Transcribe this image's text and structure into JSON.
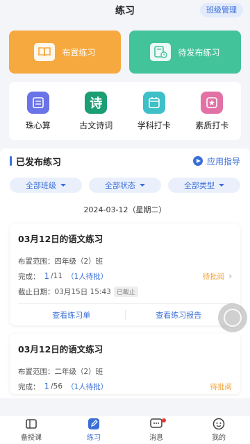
{
  "header": {
    "title": "练习",
    "class_manage": "班级管理"
  },
  "big_actions": [
    {
      "label": "布置练习",
      "icon": "book-icon"
    },
    {
      "label": "待发布练习",
      "icon": "clock-document-icon"
    }
  ],
  "shortcuts": [
    {
      "label": "珠心算",
      "icon": "abacus-icon",
      "color": "#6b73e8"
    },
    {
      "label": "古文诗词",
      "icon": "poem-icon",
      "color": "#1c9e74",
      "glyph": "诗"
    },
    {
      "label": "学科打卡",
      "icon": "calendar-icon",
      "color": "#3fc0c8"
    },
    {
      "label": "素质打卡",
      "icon": "star-badge-icon",
      "color": "#e272a6"
    }
  ],
  "published": {
    "title": "已发布练习",
    "guide_label": "应用指导",
    "filters": [
      "全部班级",
      "全部状态",
      "全部类型"
    ],
    "date": "2024-03-12（星期二）",
    "cards": [
      {
        "title": "03月12日的语文练习",
        "scope_label": "布置范围：",
        "scope_value": "四年级（2）班",
        "done_label": "完成：",
        "done_count": "1",
        "total": "/11",
        "pending": "（1人待批）",
        "status": "待批阅",
        "deadline_label": "截止日期：",
        "deadline_value": "03月15日 15:43",
        "deadline_badge": "已截止",
        "action_left": "查看练习单",
        "action_right": "查看练习报告"
      },
      {
        "title": "03月12日的语文练习",
        "scope_label": "布置范围：",
        "scope_value": "二年级（2）班",
        "done_label": "完成：",
        "done_count": "1",
        "total": "/56",
        "pending": "（1人待批）",
        "status": "待批阅"
      }
    ]
  },
  "tabbar": [
    {
      "label": "备授课",
      "icon": "book-open-icon",
      "active": false
    },
    {
      "label": "练习",
      "icon": "pencil-icon",
      "active": true
    },
    {
      "label": "消息",
      "icon": "message-icon",
      "active": false,
      "has_dot": true
    },
    {
      "label": "我的",
      "icon": "user-icon",
      "active": false
    }
  ],
  "colors": {
    "accent": "#3a6fd8",
    "orange": "#f6a93f",
    "green": "#43c39a",
    "pending": "#f0a23a"
  }
}
